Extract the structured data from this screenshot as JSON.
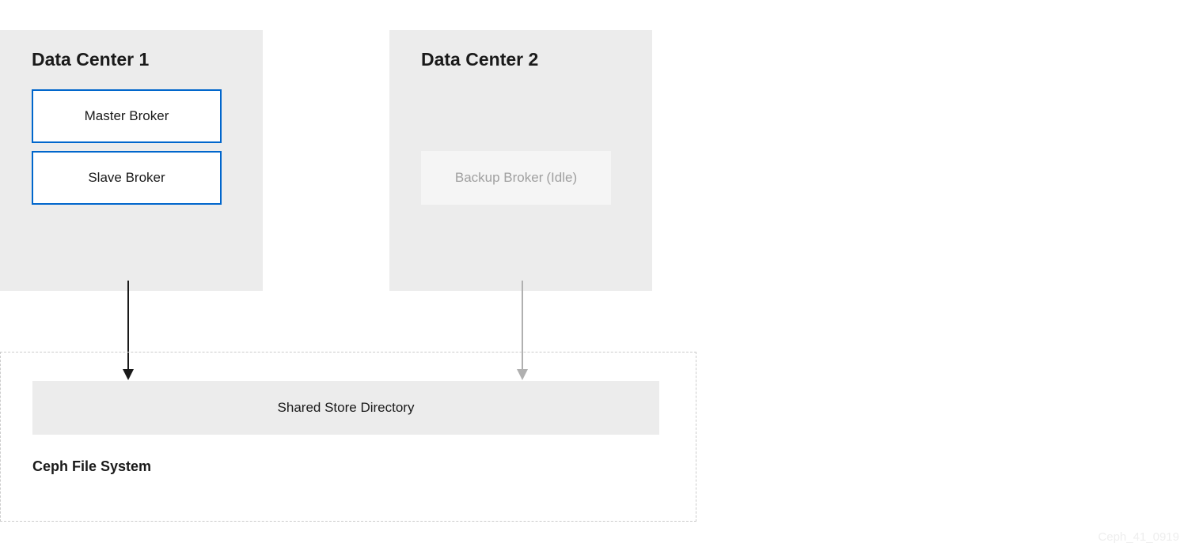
{
  "dc1": {
    "title": "Data Center 1",
    "master": "Master Broker",
    "slave": "Slave Broker"
  },
  "dc2": {
    "title": "Data Center 2",
    "backup": "Backup Broker",
    "idle": "(Idle)"
  },
  "storage": {
    "shared": "Shared Store Directory",
    "fs": "Ceph File System"
  },
  "watermark": "Ceph_41_0919"
}
